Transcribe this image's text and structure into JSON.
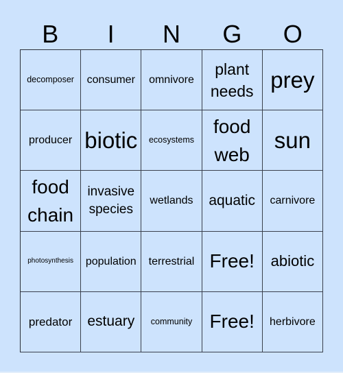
{
  "header": {
    "letters": [
      "B",
      "I",
      "N",
      "G",
      "O"
    ]
  },
  "colors": {
    "background": "#cde3fd",
    "grid_line": "#2b2f38",
    "text": "#000000"
  },
  "grid": {
    "rows": [
      [
        "decomposer",
        "consumer",
        "omnivore",
        "plant needs",
        "prey"
      ],
      [
        "producer",
        "biotic",
        "ecosystems",
        "food web",
        "sun"
      ],
      [
        "food chain",
        "invasive species",
        "wetlands",
        "aquatic",
        "carnivore"
      ],
      [
        "photosynthesis",
        "population",
        "terrestrial",
        "Free!",
        "abiotic"
      ],
      [
        "predator",
        "estuary",
        "community",
        "Free!",
        "herbivore"
      ]
    ]
  }
}
